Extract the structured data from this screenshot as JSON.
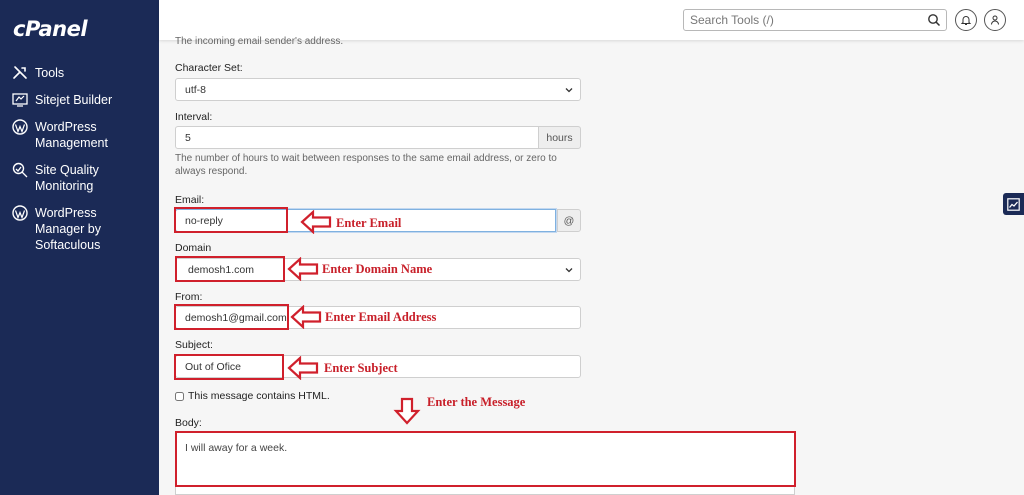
{
  "brand": {
    "logo": "cPanel"
  },
  "sidebar": {
    "items": [
      {
        "label": "Tools",
        "icon": "tools-icon"
      },
      {
        "label": "Sitejet Builder",
        "icon": "sitejet-icon"
      },
      {
        "label": "WordPress\nManagement",
        "icon": "wordpress-icon"
      },
      {
        "label": "Site Quality\nMonitoring",
        "icon": "site-quality-icon"
      },
      {
        "label": "WordPress\nManager by\nSoftaculous",
        "icon": "wordpress-icon"
      }
    ]
  },
  "header": {
    "search_placeholder": "Search Tools (/)"
  },
  "form": {
    "sender_help": "The incoming email sender's address.",
    "charset_label": "Character Set:",
    "charset_value": "utf-8",
    "interval_label": "Interval:",
    "interval_value": "5",
    "interval_unit": "hours",
    "interval_help": "The number of hours to wait between responses to the same email address, or zero to always respond.",
    "email_label": "Email:",
    "email_value": "no-reply",
    "email_suffix": "@",
    "domain_label": "Domain",
    "domain_value": "demosh1.com",
    "from_label": "From:",
    "from_value": "demosh1@gmail.com",
    "subject_label": "Subject:",
    "subject_value": "Out of Ofice",
    "html_checkbox_label": "This message contains HTML.",
    "body_label": "Body:",
    "body_value": "I will away for a week."
  },
  "annotations": {
    "email": "Enter Email",
    "domain": "Enter Domain Name",
    "from": "Enter Email Address",
    "subject": "Enter Subject",
    "body": "Enter the Message"
  },
  "colors": {
    "sidebar": "#1b2a56",
    "annotation": "#d0202c",
    "background": "#f6f6f6"
  }
}
